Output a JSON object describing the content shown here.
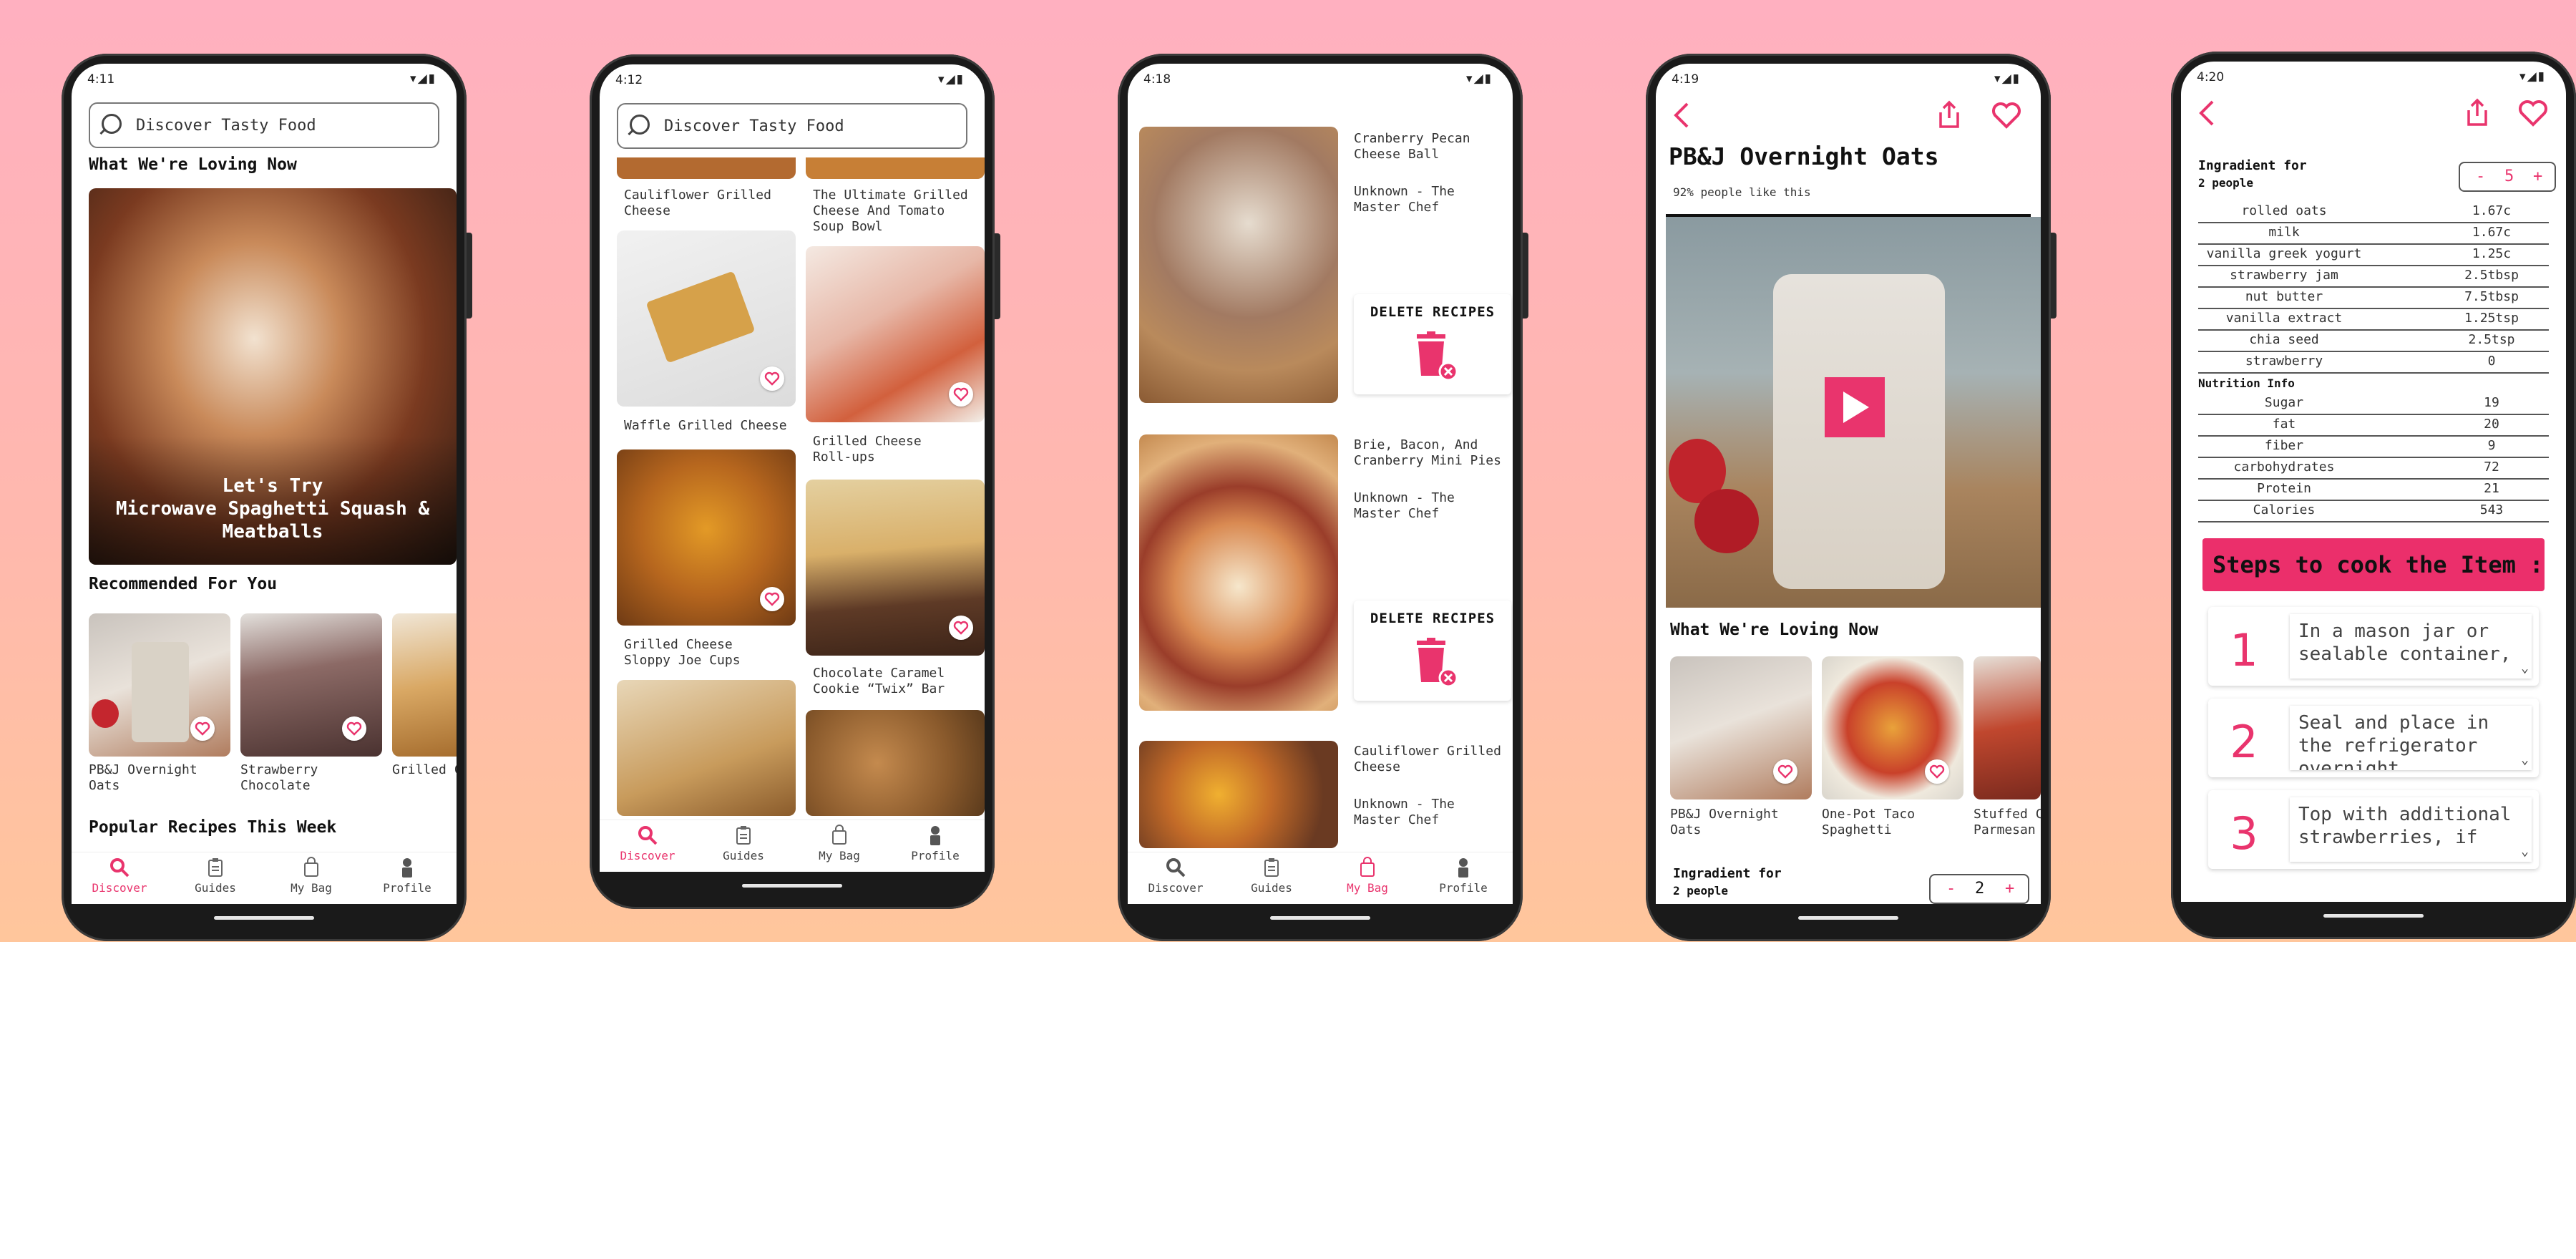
{
  "colors": {
    "accent": "#e9346d",
    "bg_top": "#ffb0c0",
    "bg_bottom": "#ffc69c"
  },
  "phone1": {
    "time": "4:11",
    "search_placeholder": "Discover Tasty Food",
    "section_loving": "What We're Loving Now",
    "hero_line1": "Let's Try",
    "hero_line2": "Microwave Spaghetti Squash &",
    "hero_line3": "Meatballs",
    "section_recommended": "Recommended For You",
    "rec": [
      {
        "line1": "PB&J Overnight",
        "line2": "Oats"
      },
      {
        "line1": "Strawberry",
        "line2": "Chocolate"
      },
      {
        "line1": "Grilled C",
        "line2": ""
      }
    ],
    "section_popular": "Popular Recipes This Week"
  },
  "tabs": {
    "discover": "Discover",
    "guides": "Guides",
    "bag": "My Bag",
    "profile": "Profile"
  },
  "phone2": {
    "time": "4:12",
    "search_placeholder": "Discover Tasty Food",
    "left": [
      {
        "line1": "Cauliflower Grilled",
        "line2": "Cheese"
      },
      {
        "line1": "Waffle Grilled Cheese",
        "line2": ""
      },
      {
        "line1": "Grilled Cheese",
        "line2": "Sloppy Joe Cups"
      }
    ],
    "right": [
      {
        "line1": "The Ultimate Grilled",
        "line2": "Cheese And Tomato",
        "line3": "Soup Bowl"
      },
      {
        "line1": "Grilled Cheese",
        "line2": "Roll-ups",
        "line3": ""
      },
      {
        "line1": "Chocolate Caramel",
        "line2": "Cookie “Twix” Bar",
        "line3": ""
      }
    ]
  },
  "phone3": {
    "time": "4:18",
    "items": [
      {
        "title1": "Cranberry Pecan",
        "title2": "Cheese Ball",
        "title3": "",
        "author1": "Unknown - The",
        "author2": "Master Chef"
      },
      {
        "title1": "Brie, Bacon, And",
        "title2": "Cranberry Mini Pies",
        "title3": "",
        "author1": "Unknown - The",
        "author2": "Master Chef"
      },
      {
        "title1": "Cauliflower Grilled",
        "title2": "Cheese",
        "title3": "",
        "author1": "Unknown - The",
        "author2": "Master Chef"
      }
    ],
    "delete_label": "DELETE RECIPES"
  },
  "phone4": {
    "time": "4:19",
    "title": "PB&J Overnight Oats",
    "likes": "92% people like this",
    "section_loving": "What We're Loving Now",
    "loving": [
      {
        "line1": "PB&J Overnight",
        "line2": "Oats"
      },
      {
        "line1": "One-Pot Taco",
        "line2": "Spaghetti"
      },
      {
        "line1": "Stuffed Ch",
        "line2": "Parmesan"
      }
    ],
    "ingredient_label1": "Ingradient for",
    "ingredient_label2": "2 people",
    "stepper_minus": "-",
    "stepper_value": "2",
    "stepper_plus": "+"
  },
  "phone5": {
    "time": "4:20",
    "ingredient_label1": "Ingradient for",
    "ingredient_label2": "2 people",
    "stepper_minus": "-",
    "stepper_value": "5",
    "stepper_plus": "+",
    "ingredients": [
      {
        "name": "rolled oats",
        "qty": "1.67c"
      },
      {
        "name": "milk",
        "qty": "1.67c"
      },
      {
        "name": "vanilla greek yogurt",
        "qty": "1.25c"
      },
      {
        "name": "strawberry jam",
        "qty": "2.5tbsp"
      },
      {
        "name": "nut butter",
        "qty": "7.5tbsp"
      },
      {
        "name": "vanilla extract",
        "qty": "1.25tsp"
      },
      {
        "name": "chia seed",
        "qty": "2.5tsp"
      },
      {
        "name": "strawberry",
        "qty": "0"
      }
    ],
    "nutrition_label": "Nutrition Info",
    "nutrition": [
      {
        "name": "Sugar",
        "qty": "19"
      },
      {
        "name": "fat",
        "qty": "20"
      },
      {
        "name": "fiber",
        "qty": "9"
      },
      {
        "name": "carbohydrates",
        "qty": "72"
      },
      {
        "name": "Protein",
        "qty": "21"
      },
      {
        "name": "Calories",
        "qty": "543"
      }
    ],
    "steps_header": "Steps to cook the Item :",
    "steps": [
      {
        "num": "1",
        "text": "In a mason jar or sealable container,"
      },
      {
        "num": "2",
        "text": "Seal and place in the refrigerator overnight"
      },
      {
        "num": "3",
        "text": "Top with additional strawberries, if"
      }
    ]
  }
}
